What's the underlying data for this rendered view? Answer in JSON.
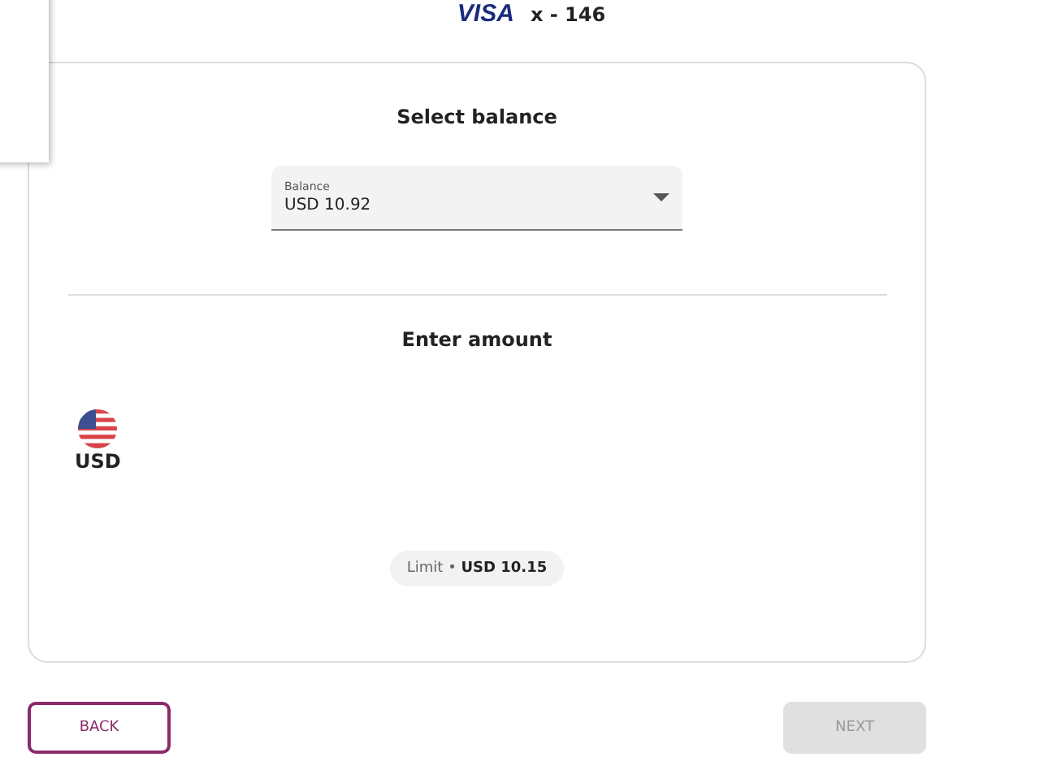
{
  "card_header": {
    "brand": "VISA",
    "number": "x - 146"
  },
  "balance_section": {
    "title": "Select balance",
    "select": {
      "label": "Balance",
      "value": "USD 10.92"
    }
  },
  "amount_section": {
    "title": "Enter amount",
    "currency": "USD",
    "limit": "Limit • **USD 10.15**"
  },
  "buttons": [
    {
      "label": "BACK",
      "kind": "outline",
      "disabled": false
    },
    {
      "label": "NEXT",
      "kind": "filled",
      "disabled": true
    }
  ]
}
